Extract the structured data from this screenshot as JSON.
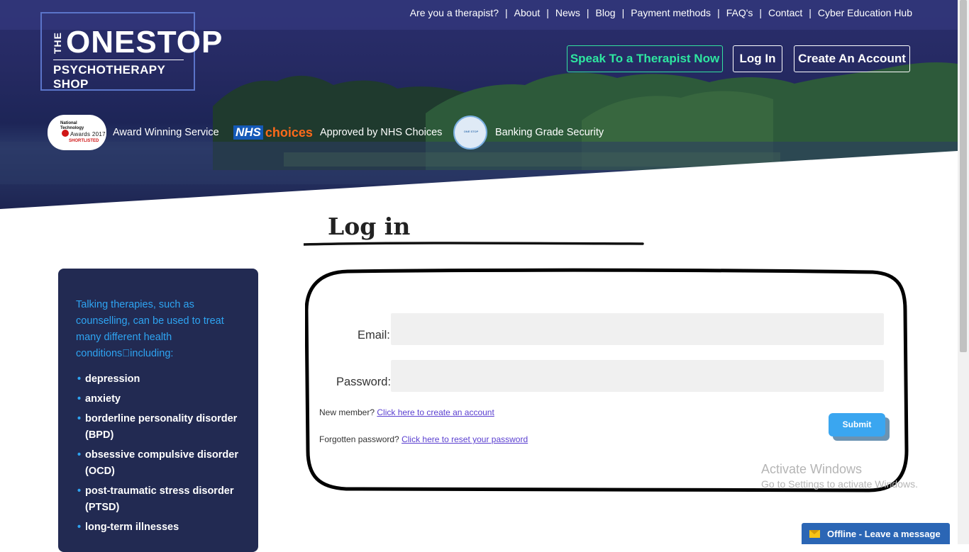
{
  "logo": {
    "the": "THE",
    "onestop": "ONESTOP",
    "subtitle": "PSYCHOTHERAPY SHOP"
  },
  "top_nav": [
    "Are you a therapist?",
    "About",
    "News",
    "Blog",
    "Payment methods",
    "FAQ's",
    "Contact",
    "Cyber Education Hub"
  ],
  "header_buttons": {
    "speak": "Speak To a Therapist Now",
    "login": "Log In",
    "create": "Create An Account"
  },
  "badges": {
    "award_logo_line1": "National",
    "award_logo_line2": "Technology",
    "award_logo_line3": "Awards 2017",
    "award_logo_line4": "SHORTLISTED",
    "award_text": "Award Winning Service",
    "nhs_logo_nhs": "NHS",
    "nhs_logo_choices": "choices",
    "nhs_text": "Approved by NHS Choices",
    "security_logo_text": "ONE STOP",
    "security_text": "Banking Grade Security"
  },
  "page_title": "Log in",
  "sidebar": {
    "intro": "Talking therapies, such as counselling, can be used to treat many different health conditions\u0000including:",
    "items": [
      "depression",
      "anxiety",
      "borderline personality disorder (BPD)",
      "obsessive compulsive disorder (OCD)",
      "post-traumatic stress disorder (PTSD)",
      "long-term illnesses"
    ]
  },
  "form": {
    "email_label": "Email:",
    "email_value": "",
    "password_label": "Password:",
    "password_value": "",
    "new_member_text": "New member?",
    "new_member_link": "Click here to create an account",
    "forgot_text": "Forgotten password?",
    "forgot_link": "Click here to reset your password",
    "submit": "Submit"
  },
  "watermark": {
    "line1": "Activate Windows",
    "line2": "Go to Settings to activate Windows."
  },
  "chat_widget": {
    "label": "Offline - Leave a message",
    "icon": "envelope-icon"
  },
  "colors": {
    "hero_bg": "#262a63",
    "accent_green": "#2ee6a0",
    "sidebar_bg": "#222a52",
    "sidebar_intro": "#2ea4f2",
    "submit_bg": "#3aa6f0",
    "chat_bg": "#2b66b5"
  }
}
